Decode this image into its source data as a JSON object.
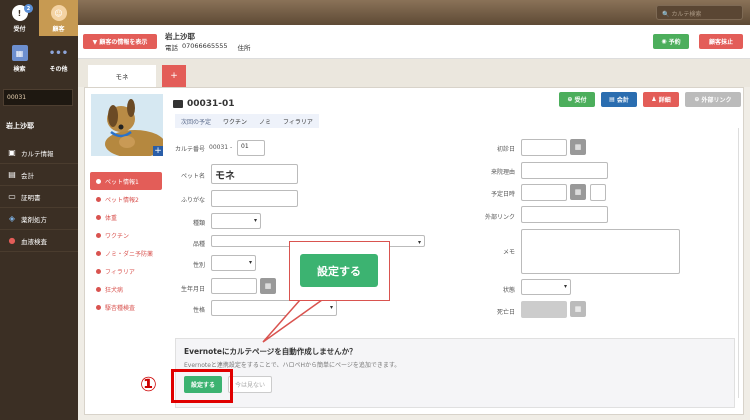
{
  "sidebar": {
    "nav": [
      {
        "label": "受付",
        "icon": "reception-icon",
        "badge": "2"
      },
      {
        "label": "顧客",
        "icon": "customer-icon"
      },
      {
        "label": "検索",
        "icon": "search-grid-icon"
      },
      {
        "label": "その他",
        "icon": "more-dots-icon"
      }
    ],
    "customer_id": "00031",
    "customer_name": "岩上沙耶",
    "menu": [
      {
        "label": "カルテ情報",
        "icon": "chart-icon"
      },
      {
        "label": "会計",
        "icon": "calculator-icon"
      },
      {
        "label": "証明書",
        "icon": "certificate-icon"
      },
      {
        "label": "薬剤処方",
        "icon": "pill-icon"
      },
      {
        "label": "血液検査",
        "icon": "blood-drop-icon"
      }
    ]
  },
  "topbar": {
    "search_placeholder": "カルテ検索"
  },
  "header": {
    "show_customer_btn": "▼ 顧客の情報を表示",
    "name": "岩上沙耶",
    "phone_label": "電話",
    "phone": "07066665555",
    "address_label": "住所",
    "reserve_btn": "予約",
    "cancel_btn": "顧客抹止"
  },
  "tabs": {
    "pet": "モネ",
    "add": "+"
  },
  "pet": {
    "number": "00031-01",
    "tag_label": "次回の予定",
    "tags": [
      "ワクチン",
      "ノミ",
      "フィラリア"
    ],
    "buttons": {
      "receive": "受付",
      "account": "会計",
      "detail": "詳細",
      "external": "外部リンク"
    }
  },
  "leftnav": [
    "ペット情報1",
    "ペット情報2",
    "体重",
    "ワクチン",
    "ノミ・ダニ予防薬",
    "フィラリア",
    "狂犬病",
    "駆杏種検査"
  ],
  "form": {
    "karte_label": "カルテ番号",
    "karte_prefix": "00031 -",
    "karte_suffix": "01",
    "petname_label": "ペット名",
    "petname": "モネ",
    "furigana_label": "ふりがな",
    "species_label": "種類",
    "breed_label": "品種",
    "sex_label": "性別",
    "birth_label": "生年月日",
    "nature_label": "性格",
    "first_visit_label": "初診日",
    "reason_label": "来院理由",
    "schedule_label": "予定日時",
    "extlink_label": "外部リンク",
    "memo_label": "メモ",
    "status_label": "状態",
    "death_label": "死亡日"
  },
  "evernote": {
    "title": "Evernoteにカルテページを自動作成しませんか？",
    "desc": "Evernoteと連携設定をすることで、ハロペHから簡単にページを追加できます。",
    "setup_btn": "設定する",
    "later_btn": "今は見ない"
  },
  "callout": {
    "label": "設定する"
  },
  "step_marker": "①"
}
